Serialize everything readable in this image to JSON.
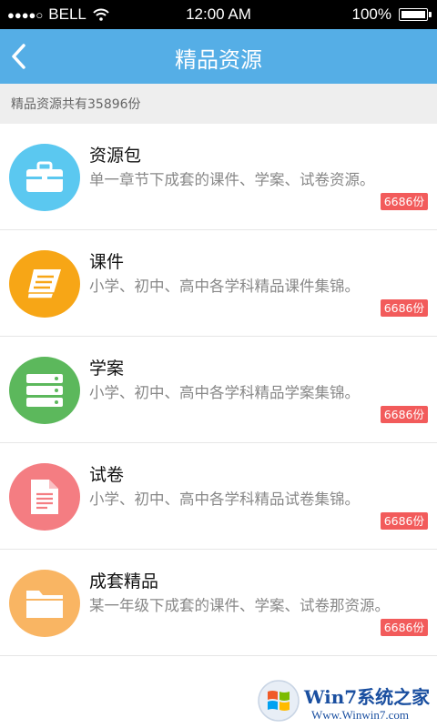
{
  "status_bar": {
    "signal": "●●●●○",
    "carrier": "BELL",
    "time": "12:00 AM",
    "battery": "100%",
    "battery_level": 1.0
  },
  "navbar": {
    "back_icon": "chevron-left-icon",
    "title": "精品资源"
  },
  "summary": {
    "text": "精品资源共有35896份"
  },
  "items": [
    {
      "name": "资源包",
      "desc": "单一章节下成套的课件、学案、试卷资源。",
      "count": "6686份",
      "icon": "briefcase-icon",
      "color": "#5bc8f0"
    },
    {
      "name": "课件",
      "desc": "小学、初中、高中各学科精品课件集锦。",
      "count": "6686份",
      "icon": "book-icon",
      "color": "#f7a616"
    },
    {
      "name": "学案",
      "desc": "小学、初中、高中各学科精品学案集锦。",
      "count": "6686份",
      "icon": "server-icon",
      "color": "#5cb85c"
    },
    {
      "name": "试卷",
      "desc": "小学、初中、高中各学科精品试卷集锦。",
      "count": "6686份",
      "icon": "document-icon",
      "color": "#f47d82"
    },
    {
      "name": "成套精品",
      "desc": "某一年级下成套的课件、学案、试卷那资源。",
      "count": "6686份",
      "icon": "folder-icon",
      "color": "#f9b563"
    }
  ],
  "watermark": {
    "title": "Win7系统之家",
    "url": "Www.Winwin7.com"
  },
  "colors": {
    "accent": "#55aee6",
    "badge": "#f25b5b"
  }
}
